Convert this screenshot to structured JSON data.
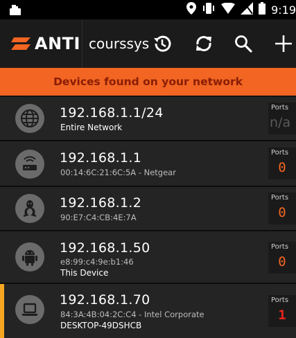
{
  "status_bar": {
    "time": "9:19",
    "icons": [
      "app-notification-icon",
      "location-pin-icon",
      "vibrate-icon",
      "wifi-icon",
      "no-signal-icon",
      "battery-icon"
    ]
  },
  "app_bar": {
    "logo_text": "ANTI",
    "network_name": "courssys",
    "actions": [
      "history-icon",
      "refresh-icon",
      "search-icon",
      "add-icon"
    ]
  },
  "banner": {
    "text": "Devices found on your network"
  },
  "colors": {
    "accent": "#f26522",
    "banner_text": "#8a1d05",
    "selected_indicator": "#f5a623",
    "vulnerable_port": "#e8251b"
  },
  "ports_label": "Ports",
  "devices": [
    {
      "icon": "globe-icon",
      "ip": "192.168.1.1/24",
      "detail": "",
      "name": "Entire Network",
      "ports": "n/a"
    },
    {
      "icon": "router-icon",
      "ip": "192.168.1.1",
      "detail": "00:14:6C:21:6C:5A - Netgear",
      "name": "",
      "ports": "0"
    },
    {
      "icon": "linux-icon",
      "ip": "192.168.1.2",
      "detail": "90:E7:C4:CB:4E:7A",
      "name": "",
      "ports": "0"
    },
    {
      "icon": "android-icon",
      "ip": "192.168.1.50",
      "detail": "e8:99:c4:9e:b1:46",
      "name": "This Device",
      "ports": "0"
    },
    {
      "icon": "laptop-icon",
      "ip": "192.168.1.70",
      "detail": "84:3A:4B:04:2C:C4 - Intel Corporate",
      "name": "DESKTOP-49DSHCB",
      "ports": "1"
    }
  ]
}
